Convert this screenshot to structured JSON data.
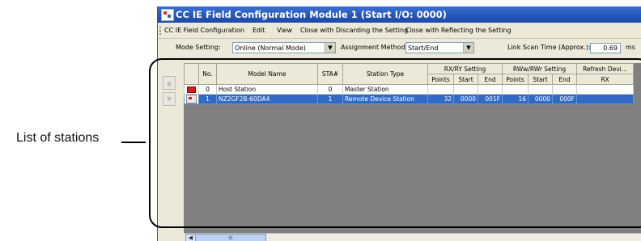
{
  "callout": {
    "text": "List of stations"
  },
  "window": {
    "title": "CC IE Field Configuration Module 1 (Start I/O: 0000)"
  },
  "menu": [
    "CC IE Field Configuration",
    "Edit",
    "View",
    "Close with Discarding the Setting",
    "Close with Reflecting the Setting"
  ],
  "toolbar": {
    "mode_label": "Mode Setting:",
    "mode_value": "Online (Normal Mode)",
    "assign_label": "Assignment Method:",
    "assign_value": "Start/End",
    "scan_label": "Link Scan Time (Approx.):",
    "scan_value": "0.69",
    "scan_unit": "ms"
  },
  "table": {
    "headers": {
      "no": "No.",
      "model": "Model Name",
      "sta": "STA#",
      "type": "Station Type",
      "rxry": "RX/RY Setting",
      "rwwrwr": "RWw/RWr Setting",
      "refresh": "Refresh Devi...",
      "points": "Points",
      "start": "Start",
      "end": "End",
      "rx": "RX"
    },
    "rows": [
      {
        "no": "0",
        "model": "Host Station",
        "sta": "0",
        "type": "Master Station",
        "rx_points": "",
        "rx_start": "",
        "rx_end": "",
        "rw_points": "",
        "rw_start": "",
        "rw_end": "",
        "refresh": "",
        "icon": "host-station-icon",
        "selected": false
      },
      {
        "no": "1",
        "model": "NZ2GF2B-60DA4",
        "sta": "1",
        "type": "Remote Device Station",
        "rx_points": "32",
        "rx_start": "0000",
        "rx_end": "001F",
        "rw_points": "16",
        "rw_start": "0000",
        "rw_end": "000F",
        "refresh": "",
        "icon": "remote-device-icon",
        "selected": true
      }
    ]
  },
  "scrollbar": {
    "thumb_grip": "III"
  },
  "colors": {
    "title_bar": "#2555b9",
    "selection": "#316AC5",
    "window_bg": "#ECE9D8",
    "empty_grid": "#808080"
  }
}
